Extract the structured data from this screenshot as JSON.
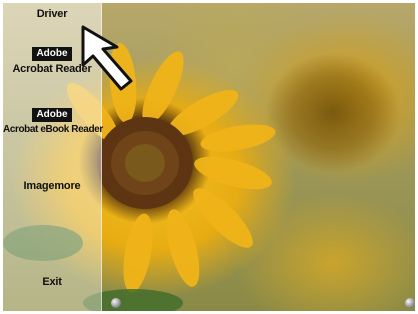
{
  "menu": {
    "items": [
      {
        "id": "driver",
        "label": "Driver"
      },
      {
        "id": "acrobat-reader",
        "logo": "Adobe",
        "label": "Acrobat Reader"
      },
      {
        "id": "acrobat-ebook-reader",
        "logo": "Adobe",
        "label": "Acrobat eBook Reader"
      },
      {
        "id": "imagemore",
        "label": "Imagemore"
      },
      {
        "id": "exit",
        "label": "Exit"
      }
    ]
  },
  "background": {
    "subject": "sunflower photo",
    "colors": {
      "petal": "#f2c020",
      "center": "#5a3410",
      "panel": "#ffffff"
    }
  },
  "cursor": {
    "icon": "arrow-cursor-icon"
  }
}
